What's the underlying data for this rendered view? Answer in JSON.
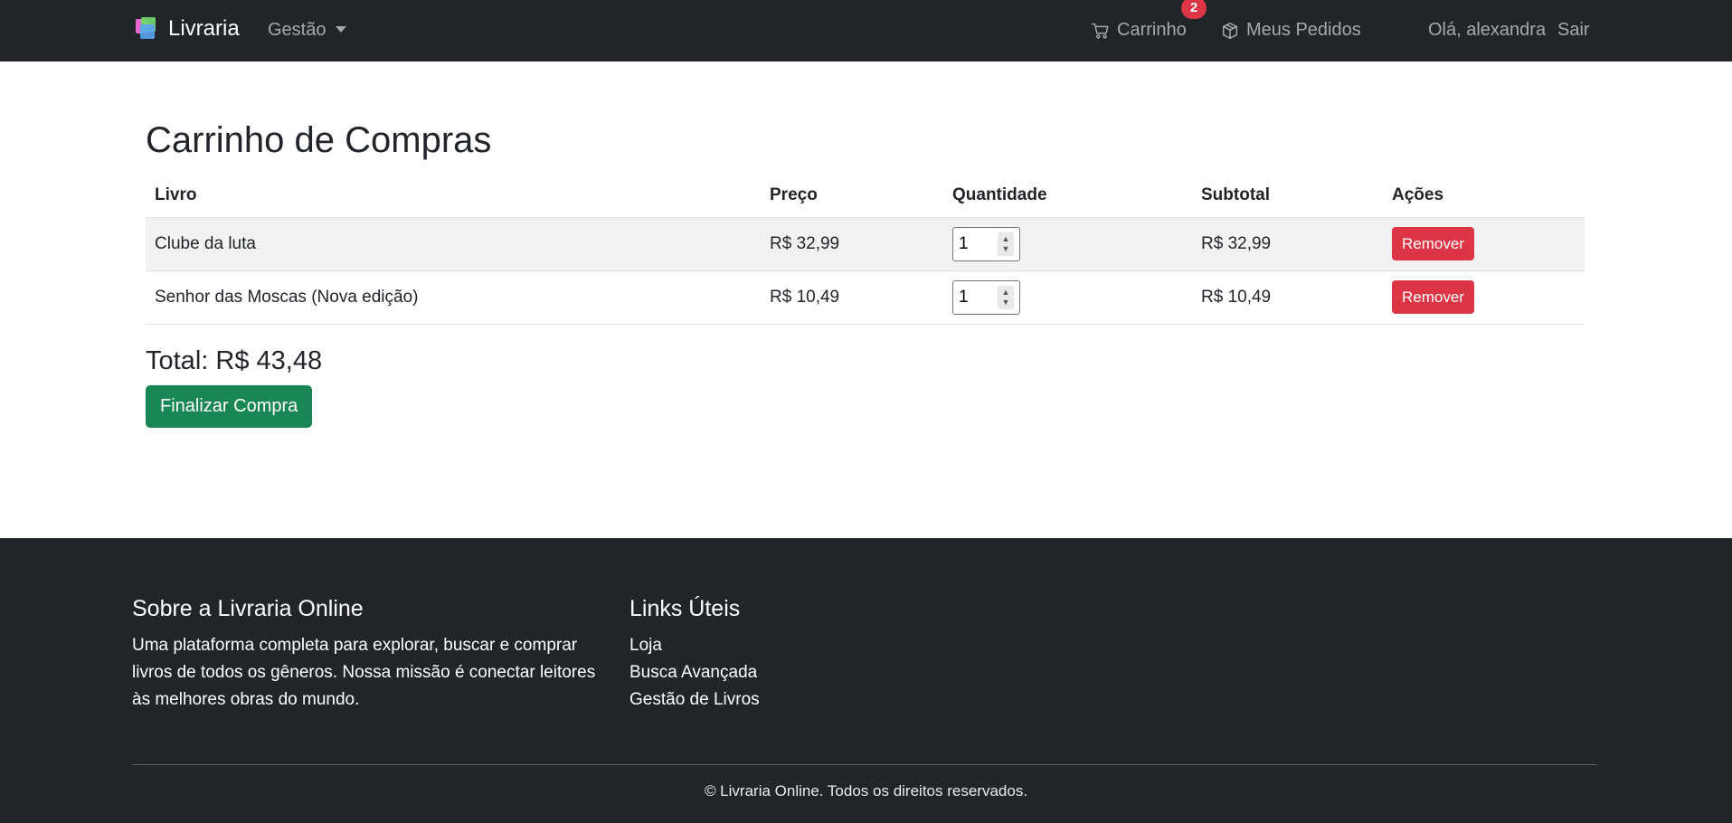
{
  "navbar": {
    "brand": "Livraria",
    "gestao": "Gestão",
    "cart": "Carrinho",
    "cart_badge": "2",
    "orders": "Meus Pedidos",
    "greeting": "Olá, alexandra",
    "logout": "Sair"
  },
  "main": {
    "title": "Carrinho de Compras",
    "headers": {
      "book": "Livro",
      "price": "Preço",
      "quantity": "Quantidade",
      "subtotal": "Subtotal",
      "actions": "Ações"
    },
    "rows": [
      {
        "book": "Clube da luta",
        "price": "R$ 32,99",
        "quantity": "1",
        "subtotal": "R$ 32,99",
        "action": "Remover"
      },
      {
        "book": "Senhor das Moscas (Nova edição)",
        "price": "R$ 10,49",
        "quantity": "1",
        "subtotal": "R$ 10,49",
        "action": "Remover"
      }
    ],
    "total": "Total: R$ 43,48",
    "finish": "Finalizar Compra"
  },
  "footer": {
    "about_title": "Sobre a Livraria Online",
    "about_text": "Uma plataforma completa para explorar, buscar e comprar livros de todos os gêneros. Nossa missão é conectar leitores às melhores obras do mundo.",
    "links_title": "Links Úteis",
    "links": [
      "Loja",
      "Busca Avançada",
      "Gestão de Livros"
    ],
    "copyright": "© Livraria Online. Todos os direitos reservados."
  },
  "colors": {
    "navbar_bg": "#212529",
    "danger": "#dc3545",
    "success": "#198754"
  },
  "icons": {
    "cart": "cart-icon",
    "orders": "box-icon",
    "brand": "books-logo-icon"
  }
}
